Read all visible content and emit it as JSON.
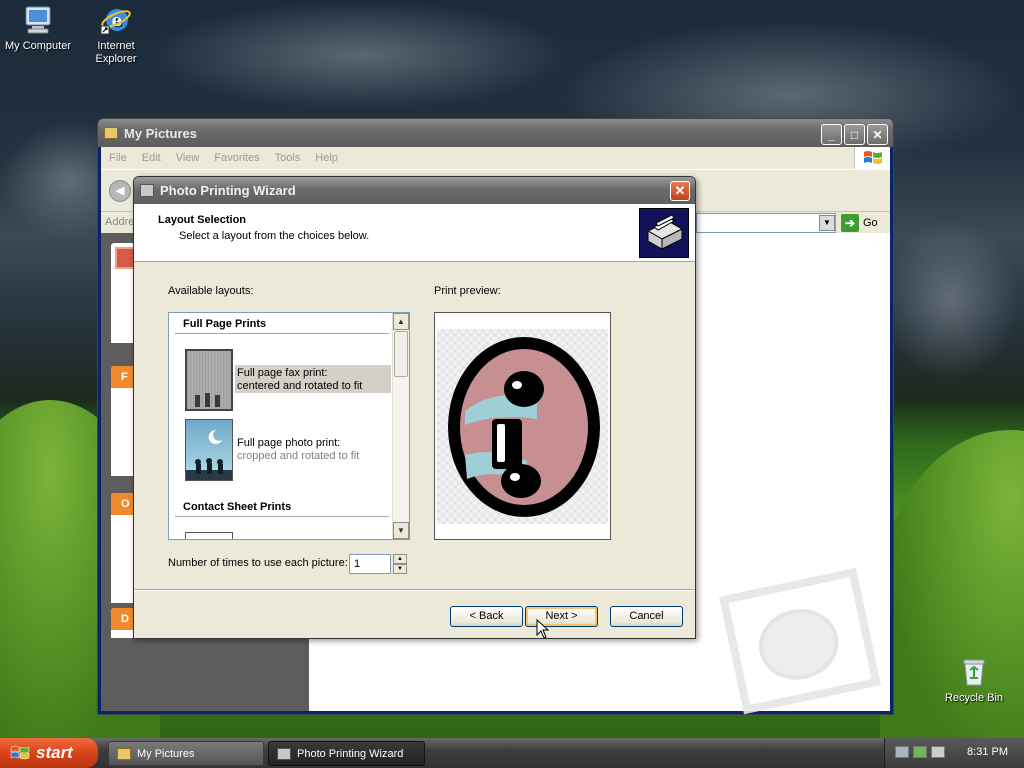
{
  "desktop": {
    "icons": [
      {
        "label": "My Computer"
      },
      {
        "label": "Internet\nExplorer"
      },
      {
        "label": "Recycle Bin"
      }
    ]
  },
  "explorer": {
    "title": "My Pictures",
    "menu": [
      "File",
      "Edit",
      "View",
      "Favorites",
      "Tools",
      "Help"
    ],
    "address_label": "Addre",
    "go_label": "Go",
    "side_headers": [
      "F",
      "O",
      "D"
    ]
  },
  "wizard": {
    "title": "Photo Printing Wizard",
    "header_title": "Layout Selection",
    "header_subtitle": "Select a layout from the choices below.",
    "available_layouts_label": "Available layouts:",
    "print_preview_label": "Print preview:",
    "groups": [
      {
        "name": "Full Page Prints"
      },
      {
        "name": "Contact Sheet Prints"
      }
    ],
    "layouts": [
      {
        "line1": "Full page fax print:",
        "line2": "centered and rotated to fit",
        "selected": true
      },
      {
        "line1": "Full page photo print:",
        "line2": "cropped and rotated to fit",
        "selected": false
      }
    ],
    "copies_label": "Number of times to use each picture:",
    "copies_value": "1",
    "buttons": {
      "back": "< Back",
      "next": "Next >",
      "cancel": "Cancel"
    }
  },
  "taskbar": {
    "start_label": "start",
    "tasks": [
      {
        "label": "My Pictures",
        "active": false
      },
      {
        "label": "Photo Printing Wizard",
        "active": true
      }
    ],
    "clock": "8:31 PM"
  },
  "colors": {
    "title_gray": "#6b6b6b",
    "start_orange": "#d8451b",
    "close_red": "#c2401a",
    "face_pink": "#c78f92",
    "face_blue": "#9fcfd6"
  }
}
